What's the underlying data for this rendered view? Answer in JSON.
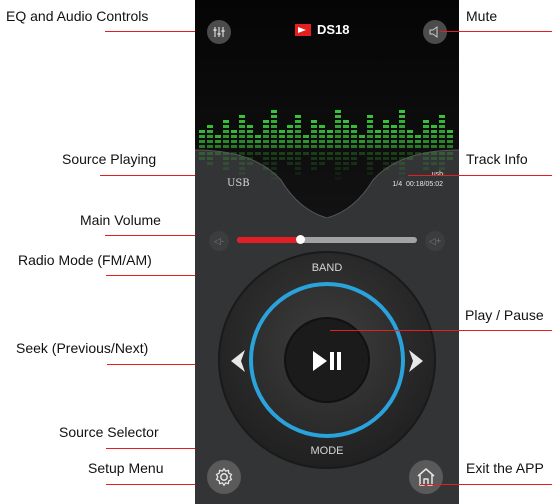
{
  "annotations": {
    "eq": "EQ and Audio Controls",
    "mute": "Mute",
    "source_playing": "Source Playing",
    "track_info": "Track Info",
    "main_volume": "Main Volume",
    "radio_mode": "Radio Mode (FM/AM)",
    "play_pause": "Play / Pause",
    "seek": "Seek (Previous/Next)",
    "source_selector": "Source Selector",
    "setup_menu": "Setup Menu",
    "exit_app": "Exit the APP"
  },
  "app": {
    "brand": "DS18",
    "source": "USB",
    "track_source": "usb",
    "track_position": "1/4",
    "track_time": "00:18/05:02",
    "band_label": "BAND",
    "mode_label": "MODE",
    "volume_level": 0.35,
    "colors": {
      "accent": "#e31e24",
      "ring": "#2aa3dc",
      "eq_green": "#3ecf3e",
      "panel": "#333435"
    },
    "icons": {
      "eq": "eq-sliders-icon",
      "mute": "speaker-icon",
      "settings": "gear-icon",
      "home": "home-icon"
    }
  }
}
